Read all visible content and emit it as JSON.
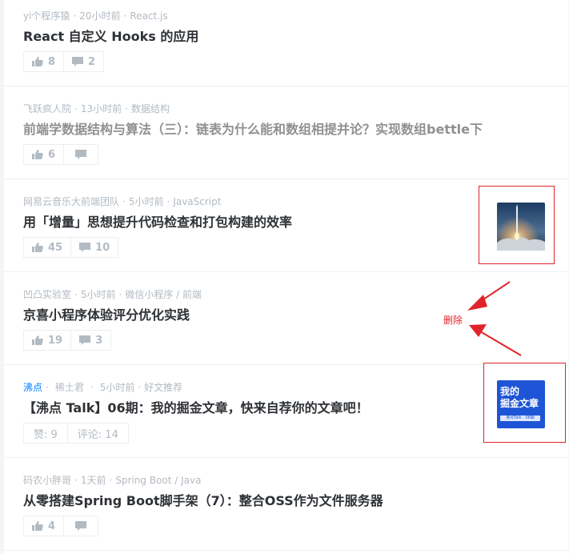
{
  "articles": [
    {
      "meta": [
        "yi个程序猿",
        "20小时前",
        "React.js"
      ],
      "title": "React 自定义 Hooks 的应用",
      "likes": "8",
      "comments": "2"
    },
    {
      "meta": [
        "飞跃疯人院",
        "13小时前",
        "数据结构"
      ],
      "title": "前端学数据结构与算法（三）：链表为什么能和数组相提并论？实现数组bettle下",
      "likes": "6",
      "comments": ""
    },
    {
      "meta": [
        "网易云音乐大前端团队",
        "5小时前",
        "JavaScript"
      ],
      "title": "用「增量」思想提升代码检查和打包构建的效率",
      "likes": "45",
      "comments": "10"
    },
    {
      "meta": [
        "凹凸实验室",
        "5小时前",
        "微信小程序 / 前端"
      ],
      "title": "京喜小程序体验评分优化实践",
      "likes": "19",
      "comments": "3"
    },
    {
      "meta": [
        "沸点",
        "稀土君",
        "5小时前",
        "好文推荐"
      ],
      "title": "【沸点 Talk】06期：我的掘金文章，快来自荐你的文章吧！",
      "likes": "赞: 9",
      "comments": "评论: 14",
      "thumb_text": "我的\n掘金文章",
      "thumb_badge": "沸点Talk · 06期"
    },
    {
      "meta": [
        "码农小胖哥",
        "1天前",
        "Spring Boot / Java"
      ],
      "title": "从零搭建Spring Boot脚手架（7）：整合OSS作为文件服务器",
      "likes": "4",
      "comments": ""
    }
  ],
  "annotation": {
    "label": "删除",
    "color": "#e0242b"
  },
  "colors": {
    "meta": "#b2bac2",
    "title": "#2e3135",
    "title_read": "#909090",
    "link": "#007fff",
    "thumb_blue": "#1e55d6"
  },
  "icons": [
    "thumbs-up-icon",
    "comment-icon",
    "rocket-launch-image"
  ]
}
